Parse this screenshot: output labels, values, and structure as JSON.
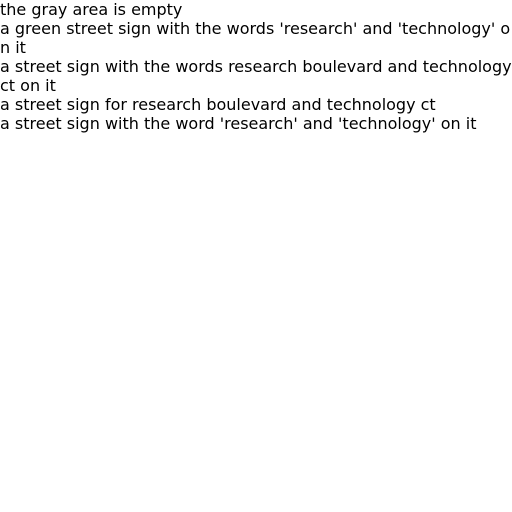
{
  "captions": [
    "the gray area is empty",
    "a green street sign with the words 'research' and 'technology' on it",
    "a street sign with the words research boulevard and technology ct on it",
    "a street sign for research boulevard and technology ct",
    "a street sign with the word 'research' and 'technology' on it"
  ]
}
